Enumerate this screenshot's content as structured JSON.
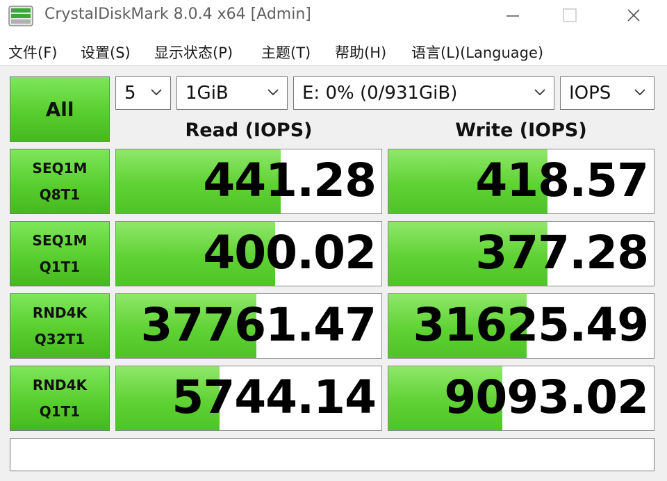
{
  "window": {
    "title": "CrystalDiskMark 8.0.4 x64 [Admin]"
  },
  "menu": {
    "items": [
      "文件(F)",
      "设置(S)",
      "显示状态(P)",
      "主题(T)",
      "帮助(H)",
      "语言(L)(Language)"
    ]
  },
  "controls": {
    "all_label": "All",
    "count_value": "5",
    "size_value": "1GiB",
    "drive_value": "E: 0% (0/931GiB)",
    "unit_value": "IOPS"
  },
  "headers": {
    "read": "Read (IOPS)",
    "write": "Write (IOPS)"
  },
  "tests": [
    {
      "line1": "SEQ1M",
      "line2": "Q8T1",
      "read": "441.28",
      "write": "418.57",
      "read_fill": 0.62,
      "write_fill": 0.6
    },
    {
      "line1": "SEQ1M",
      "line2": "Q1T1",
      "read": "400.02",
      "write": "377.28",
      "read_fill": 0.6,
      "write_fill": 0.6
    },
    {
      "line1": "RND4K",
      "line2": "Q32T1",
      "read": "37761.47",
      "write": "31625.49",
      "read_fill": 0.53,
      "write_fill": 0.52
    },
    {
      "line1": "RND4K",
      "line2": "Q1T1",
      "read": "5744.14",
      "write": "9093.02",
      "read_fill": 0.39,
      "write_fill": 0.43
    }
  ],
  "comment": {
    "value": ""
  },
  "colors": {
    "bar_green": "#5fd234",
    "button_green": "#56cc2c"
  }
}
